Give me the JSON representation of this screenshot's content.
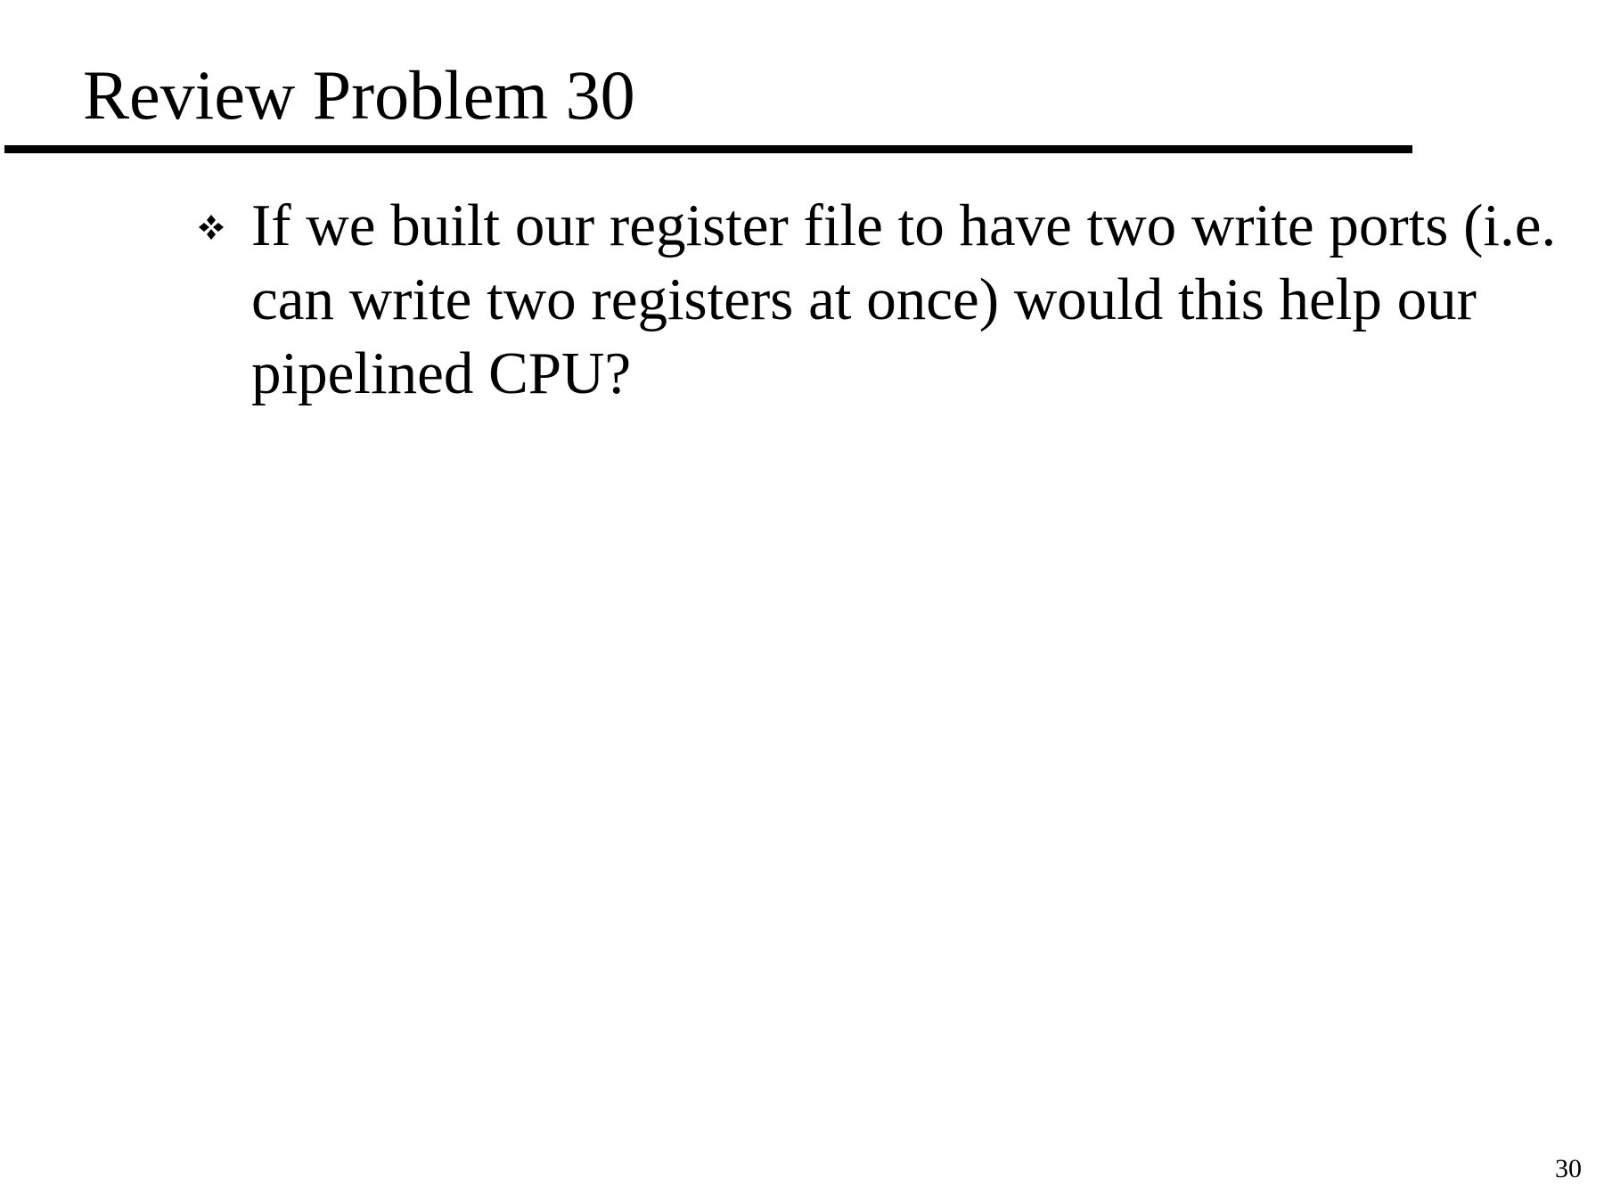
{
  "slide": {
    "title": "Review Problem 30",
    "bullets": [
      {
        "icon": "diamond-bullet-icon",
        "text": "If we built our register file to have two write ports (i.e. can write two registers at once) would this help our pipelined CPU?"
      }
    ],
    "page_number": "30"
  },
  "colors": {
    "text": "#000000",
    "background": "#ffffff",
    "rule": "#000000"
  }
}
